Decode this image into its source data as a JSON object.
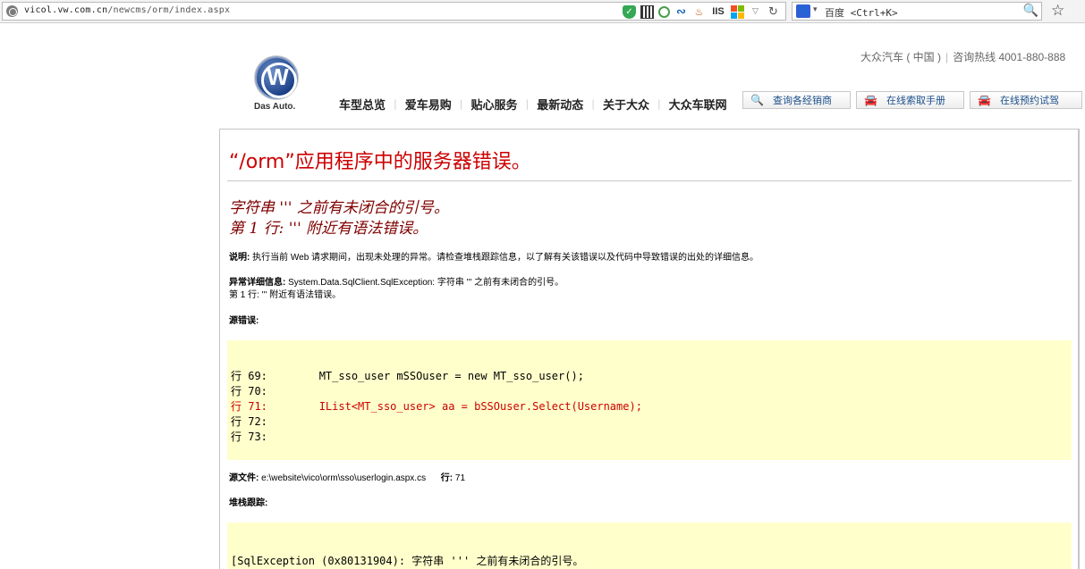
{
  "browser": {
    "url_host": "vicol.vw.com.cn",
    "url_path": "/newcms/orm/index.aspx",
    "search_engine": "百度",
    "search_placeholder": "百度 <Ctrl+K>",
    "addon_iis_label": "IIS",
    "icons": [
      "globe-icon",
      "shield-icon",
      "qr-icon",
      "ring-icon",
      "wave-icon",
      "java-icon",
      "iis-icon",
      "windows-icon",
      "dropdown-icon",
      "reload-icon",
      "baidu-icon",
      "search-icon",
      "star-icon"
    ]
  },
  "header": {
    "brand_link": "大众汽车 ( 中国 )",
    "hotline": "咨询热线 4001-880-888",
    "logo_tagline": "Das Auto.",
    "nav": [
      "车型总览",
      "爱车易购",
      "贴心服务",
      "最新动态",
      "关于大众",
      "大众车联网"
    ],
    "services": [
      "查询各经销商",
      "在线索取手册",
      "在线预约试驾"
    ]
  },
  "error": {
    "title": "“/orm”应用程序中的服务器错误。",
    "message_line1": "字符串 ''' 之前有未闭合的引号。",
    "message_line2": "第 1 行: ''' 附近有语法错误。",
    "desc_label": "说明:",
    "desc_text": "执行当前 Web 请求期间，出现未处理的异常。请检查堆栈跟踪信息，以了解有关该错误以及代码中导致错误的出处的详细信息。",
    "exc_label": "异常详细信息:",
    "exc_text": "System.Data.SqlClient.SqlException: 字符串 ''' 之前有未闭合的引号。",
    "exc_text2": "第 1 行: ''' 附近有语法错误。",
    "src_error_label": "源错误:",
    "code_lines": [
      {
        "num": "行 69:",
        "code": "        MT_sso_user mSSOuser = new MT_sso_user();"
      },
      {
        "num": "行 70:",
        "code": ""
      },
      {
        "num": "行 71:",
        "code": "        IList<MT_sso_user> aa = bSSOuser.Select(Username);"
      },
      {
        "num": "行 72:",
        "code": ""
      },
      {
        "num": "行 73:",
        "code": ""
      }
    ],
    "src_file_label": "源文件:",
    "src_file": "e:\\website\\vico\\orm\\sso\\userlogin.aspx.cs",
    "line_label": "行:",
    "line_value": "71",
    "stack_label": "堆栈跟踪:",
    "stack_first": "[SqlException (0x80131904): 字符串 ''' 之前有未闭合的引号。"
  }
}
